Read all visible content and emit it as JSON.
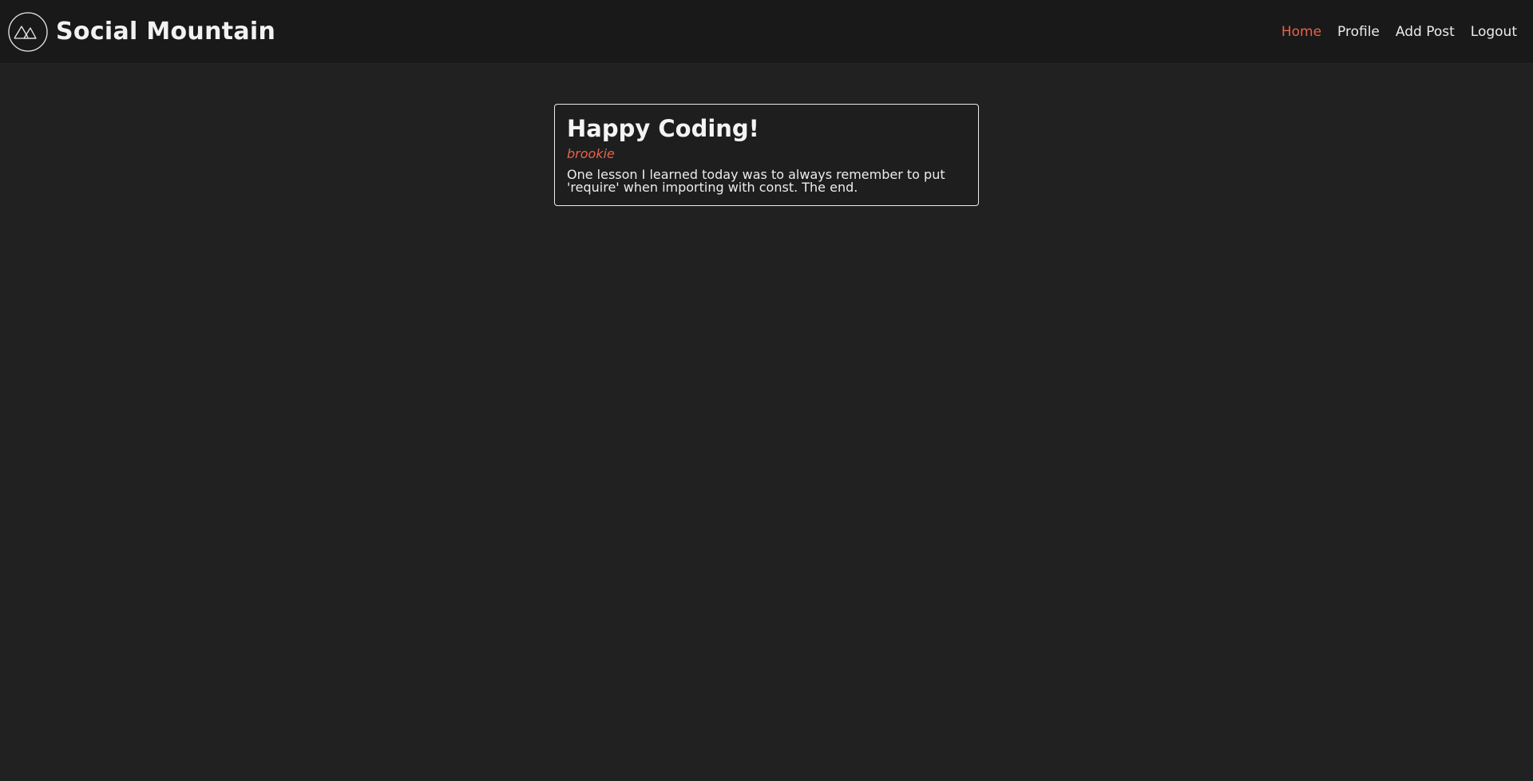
{
  "header": {
    "brand": "Social Mountain",
    "logo_icon": "mountain-logo-icon",
    "nav": {
      "home": "Home",
      "profile": "Profile",
      "add_post": "Add Post",
      "logout": "Logout"
    }
  },
  "posts": [
    {
      "title": "Happy Coding!",
      "author": "brookie",
      "body": "One lesson I learned today was to always remember to put 'require' when importing with const. The end."
    }
  ],
  "colors": {
    "accent": "#e8624a",
    "background": "#212121",
    "header_background": "#191919"
  }
}
